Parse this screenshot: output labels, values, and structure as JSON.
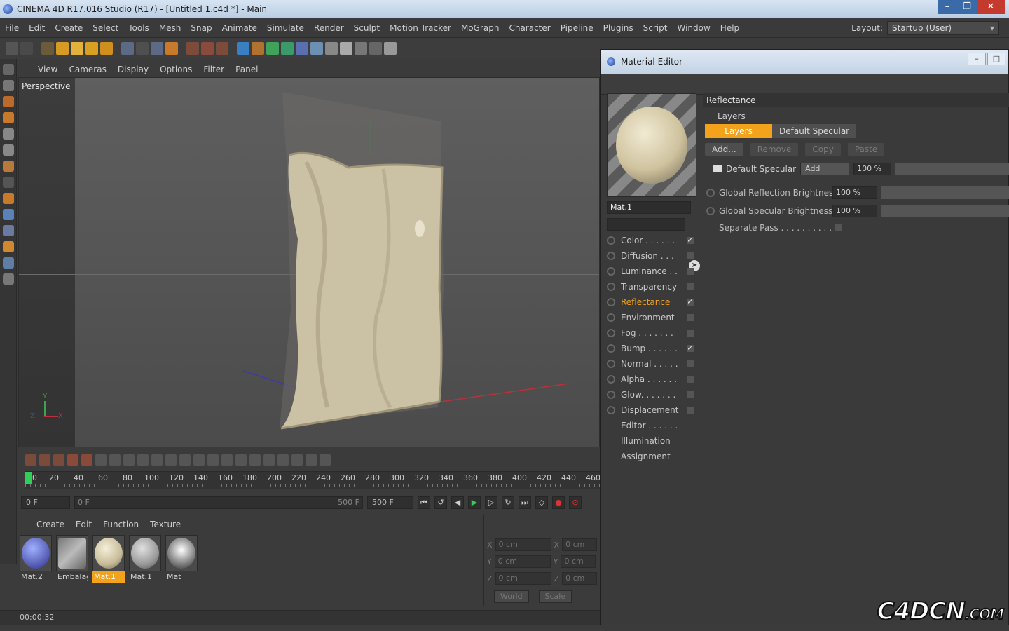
{
  "window": {
    "title": "CINEMA 4D R17.016 Studio (R17) - [Untitled 1.c4d *] - Main"
  },
  "menubar": {
    "items": [
      "File",
      "Edit",
      "Create",
      "Select",
      "Tools",
      "Mesh",
      "Snap",
      "Animate",
      "Simulate",
      "Render",
      "Sculpt",
      "Motion Tracker",
      "MoGraph",
      "Character",
      "Pipeline",
      "Plugins",
      "Script",
      "Window",
      "Help"
    ],
    "layout_label": "Layout:",
    "layout_value": "Startup (User)"
  },
  "viewport": {
    "menu": [
      "View",
      "Cameras",
      "Display",
      "Options",
      "Filter",
      "Panel"
    ],
    "label": "Perspective",
    "axis_y": "Y",
    "axis_x": "X",
    "axis_z": "Z"
  },
  "timeline": {
    "ticks": [
      "0",
      "20",
      "40",
      "60",
      "80",
      "100",
      "120",
      "140",
      "160",
      "180",
      "200",
      "220",
      "240",
      "260",
      "280",
      "300",
      "320",
      "340",
      "360",
      "380",
      "400",
      "420",
      "440",
      "460"
    ],
    "current_frame": "0 F",
    "range_start": "0 F",
    "range_end": "500 F",
    "max_frame": "500 F"
  },
  "material_manager": {
    "menu": [
      "Create",
      "Edit",
      "Function",
      "Texture"
    ],
    "materials": [
      {
        "name": "Mat.2",
        "selected": false
      },
      {
        "name": "Embalag",
        "selected": false
      },
      {
        "name": "Mat.1",
        "selected": true
      },
      {
        "name": "Mat.1",
        "selected": false
      },
      {
        "name": "Mat",
        "selected": false
      }
    ]
  },
  "coordinates": {
    "rows": [
      {
        "axis": "X",
        "value": "0 cm",
        "axis2": "X",
        "value2": "0 cm"
      },
      {
        "axis": "Y",
        "value": "0 cm",
        "axis2": "Y",
        "value2": "0 cm"
      },
      {
        "axis": "Z",
        "value": "0 cm",
        "axis2": "Z",
        "value2": "0 cm"
      }
    ],
    "mode": "World",
    "apply": "Scale"
  },
  "status": {
    "time": "00:00:32"
  },
  "material_editor": {
    "title": "Material Editor",
    "material_name": "Mat.1",
    "channels": [
      {
        "label": "Color . . . . . .",
        "checked": true,
        "active": false,
        "has_radio": true
      },
      {
        "label": "Diffusion . . .",
        "checked": false,
        "active": false,
        "has_radio": true
      },
      {
        "label": "Luminance . .",
        "checked": false,
        "active": false,
        "has_radio": true
      },
      {
        "label": "Transparency",
        "checked": false,
        "active": false,
        "has_radio": true
      },
      {
        "label": "Reflectance",
        "checked": true,
        "active": true,
        "has_radio": true
      },
      {
        "label": "Environment",
        "checked": false,
        "active": false,
        "has_radio": true
      },
      {
        "label": "Fog . . . . . . .",
        "checked": false,
        "active": false,
        "has_radio": true
      },
      {
        "label": "Bump . . . . . .",
        "checked": true,
        "active": false,
        "has_radio": true
      },
      {
        "label": "Normal . . . . .",
        "checked": false,
        "active": false,
        "has_radio": true
      },
      {
        "label": "Alpha . . . . . .",
        "checked": false,
        "active": false,
        "has_radio": true
      },
      {
        "label": "Glow. . . . . . .",
        "checked": false,
        "active": false,
        "has_radio": true
      },
      {
        "label": "Displacement",
        "checked": false,
        "active": false,
        "has_radio": true
      },
      {
        "label": "Editor . . . . . .",
        "checked": null,
        "active": false,
        "has_radio": false
      },
      {
        "label": "Illumination",
        "checked": null,
        "active": false,
        "has_radio": false
      },
      {
        "label": "Assignment",
        "checked": null,
        "active": false,
        "has_radio": false
      }
    ],
    "section": "Reflectance",
    "layers_label": "Layers",
    "tabs": [
      "Layers",
      "Default Specular"
    ],
    "buttons": [
      "Add...",
      "Remove",
      "Copy",
      "Paste"
    ],
    "layer": {
      "name": "Default Specular",
      "mode": "Add",
      "amount": "100 %"
    },
    "props": [
      {
        "label": "Global Reflection Brightness",
        "value": "100 %"
      },
      {
        "label": "Global Specular Brightness",
        "value": "100 %"
      }
    ],
    "separate_pass": "Separate Pass . . . . . . . . . . . ."
  },
  "watermark": {
    "text": "C4DCN",
    "suffix": ".COM"
  },
  "colors": {
    "accent": "#f3a21b",
    "timeline_playhead": "#2fcf5a"
  }
}
